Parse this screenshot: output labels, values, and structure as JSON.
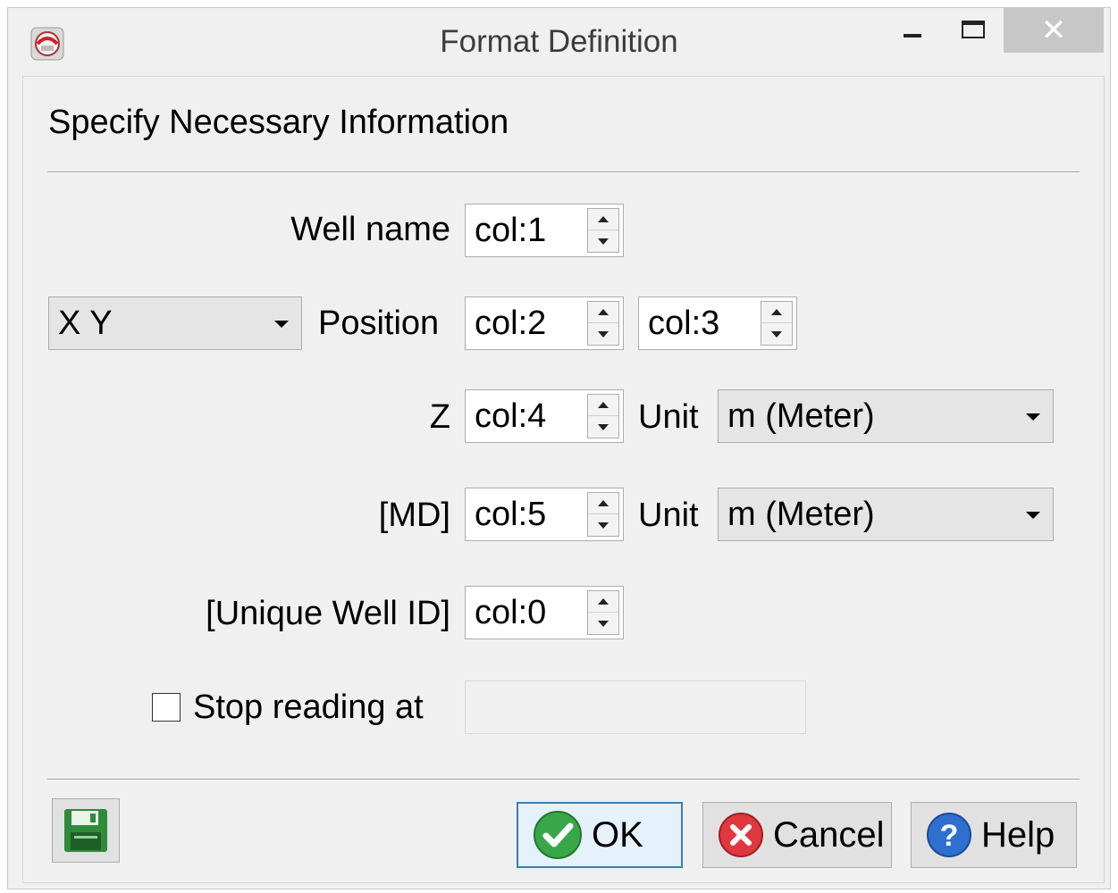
{
  "window": {
    "title": "Format Definition",
    "close_glyph": "✕"
  },
  "heading": "Specify Necessary Information",
  "form": {
    "well_name": {
      "label": "Well name",
      "value": "col:1"
    },
    "position": {
      "type_selected": "X Y",
      "label": "Position",
      "x_value": "col:2",
      "y_value": "col:3"
    },
    "z": {
      "label": "Z",
      "value": "col:4",
      "unit_label": "Unit",
      "unit_selected": "m (Meter)"
    },
    "md": {
      "label": "[MD]",
      "value": "col:5",
      "unit_label": "Unit",
      "unit_selected": "m (Meter)"
    },
    "unique_id": {
      "label": "[Unique Well ID]",
      "value": "col:0"
    },
    "stop_reading": {
      "label": "Stop reading at",
      "checked": false,
      "value": ""
    }
  },
  "buttons": {
    "ok": "OK",
    "cancel": "Cancel",
    "help": "Help"
  },
  "icons": {
    "app": "app-icon",
    "save": "floppy-disk-icon",
    "ok": "green-check-icon",
    "cancel": "red-x-icon",
    "help": "blue-question-icon"
  },
  "colors": {
    "ok_green": "#3aa64a",
    "cancel_red": "#e0383e",
    "help_blue": "#2f6fd0",
    "default_button_border": "#3c7fb1"
  }
}
